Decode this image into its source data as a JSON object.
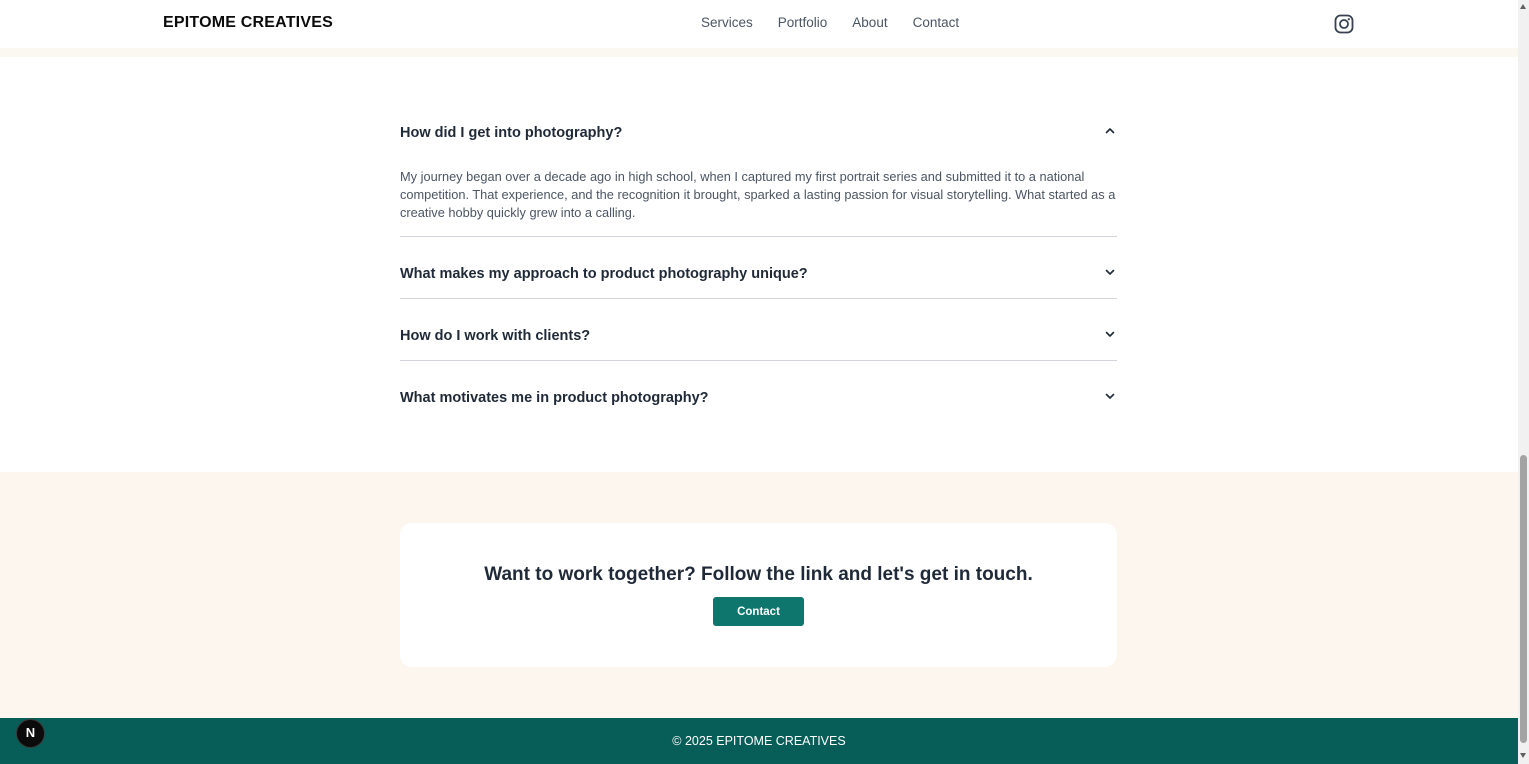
{
  "header": {
    "logo": "EPITOME CREATIVES",
    "nav": [
      "Services",
      "Portfolio",
      "About",
      "Contact"
    ],
    "social_icon": "instagram-icon"
  },
  "faq": {
    "items": [
      {
        "question": "How did I get into photography?",
        "answer": "My journey began over a decade ago in high school, when I captured my first portrait series and submitted it to a national competition. That experience, and the recognition it brought, sparked a lasting passion for visual storytelling. What started as a creative hobby quickly grew into a calling.",
        "open": true,
        "icon": "chevron-up-icon"
      },
      {
        "question": "What makes my approach to product photography unique?",
        "open": false,
        "icon": "chevron-down-icon"
      },
      {
        "question": "How do I work with clients?",
        "open": false,
        "icon": "chevron-down-icon"
      },
      {
        "question": "What motivates me in product photography?",
        "open": false,
        "icon": "chevron-down-icon"
      }
    ]
  },
  "cta": {
    "title": "Want to work together? Follow the link and let's get in touch.",
    "button_label": "Contact"
  },
  "footer": {
    "copyright": "© 2025 EPITOME CREATIVES"
  },
  "badge": {
    "label": "N"
  },
  "colors": {
    "accent": "#0f766e",
    "footer_bg": "#075e58",
    "cta_bg": "#fdf6ee",
    "text_dark": "#1f2937",
    "text_muted": "#4b5563"
  }
}
